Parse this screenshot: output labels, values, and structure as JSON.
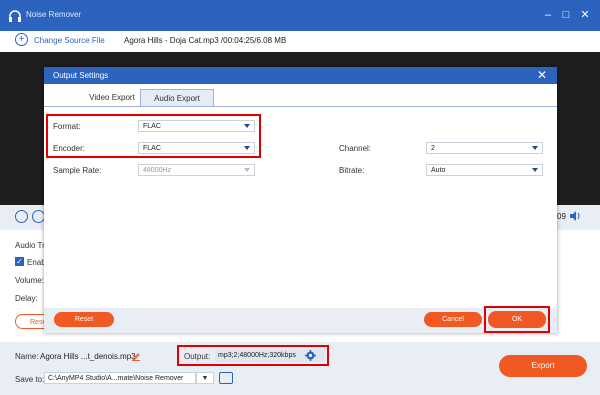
{
  "app": {
    "title": "Noise Remover"
  },
  "toolbar": {
    "change_source_label": "Change Source File",
    "file_info": "Agora Hills - Doja Cat.mp3    /00:04:25/6.08 MB"
  },
  "player": {
    "time_tail": "09"
  },
  "left_panel": {
    "audio_track_label": "Audio Tra",
    "enable_label": "Enabl",
    "volume_label": "Volume:",
    "delay_label": "Delay:",
    "reset_partial": "Rese"
  },
  "dialog": {
    "title": "Output Settings",
    "tabs": [
      "Video Export",
      "Audio Export"
    ],
    "active_tab": "Audio Export",
    "format": {
      "label": "Format:",
      "value": "FLAC"
    },
    "encoder": {
      "label": "Encoder:",
      "value": "FLAC"
    },
    "sample_rate": {
      "label": "Sample Rate:",
      "value": "48000Hz"
    },
    "channel": {
      "label": "Channel:",
      "value": "2"
    },
    "bitrate": {
      "label": "Bitrate:",
      "value": "Auto"
    },
    "reset_label": "Reset",
    "cancel_label": "Cancel",
    "ok_label": "OK"
  },
  "bottom": {
    "name_label": "Name:",
    "name_value": "Agora Hills ...t_denois.mp3",
    "output_label": "Output:",
    "output_value": "mp3;2;48000Hz;320kbps",
    "save_to_label": "Save to:",
    "save_to_value": "C:\\AnyMP4 Studio\\A...mate\\Noise Remover",
    "export_label": "Export"
  },
  "colors": {
    "accent": "#2b63bf",
    "orange": "#f05a22",
    "highlight": "#e00000"
  }
}
